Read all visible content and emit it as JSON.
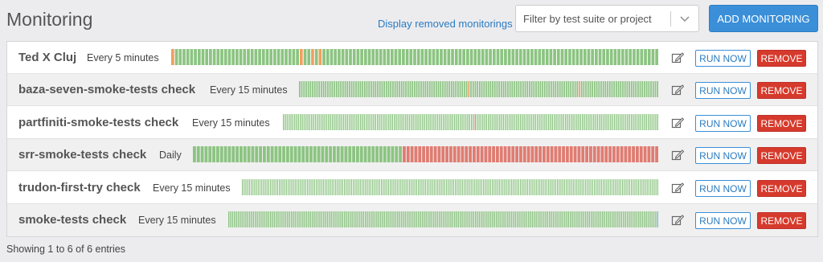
{
  "header": {
    "title": "Monitoring",
    "removed_link": "Display removed monitorings",
    "filter_placeholder": "Filter by test suite or project",
    "filter_icon": "chevron-down-icon",
    "add_label": "ADD MONITORING"
  },
  "colors": {
    "ok": "#8cc482",
    "warn": "#f0a060",
    "fail": "#e07c72",
    "running": "#7fb3e8",
    "primary": "#3a8fd8",
    "danger": "#d63a2c"
  },
  "actions": {
    "edit_icon": "edit-icon",
    "run_label": "RUN NOW",
    "remove_label": "REMOVE"
  },
  "monitorings": [
    {
      "name": "Ted X Cluj",
      "frequency": "Every 5 minutes",
      "history": "WOOOOOOOOOOOOOOOOOOOOOOOOOOOOOOOOOWOOWOWOOOOOOOOOOOOOOOOOOOOOOOOOOOOOOOOOOOOOOOOOOOOOOOOOOOOOOOOOOOOOOOOOOOOOOOOOOOOOOOOOOOOOOOOO"
    },
    {
      "name": "baza-seven-smoke-tests check",
      "frequency": "Every 15 minutes",
      "history": "OOOOOOOOOOOOOOOOOOOOOOOOOOOOOOOOOOOOOOOOOOOOOOOOOOOOOOOOOOOOOOOOOOOOOOOOOOOOOOWOOOOOOOOOOOOOOOOOOOOOOOOOOOOOOOOOOOOOOOOOOOOOOOOOOWOOOOOOOOOOOOOOOOOOOOOOOOOOOOOOOOOOOO"
    },
    {
      "name": "partfiniti-smoke-tests check",
      "frequency": "Every 15 minutes",
      "history": "OOOOOOOOOOOOOOOOOOOOOOOOOOOOOOOOOOOOOOOOOOOOOOOOOOOOOOOOOOOOOOOOOOOOOOOOOOOOOOOOOOOOOOOOOOOOOOOOOOOOOOFOOOOOOOOOOOOOOOOOOOOOOOOOOOOOOOOOOOOOOOOOOOOOOOOOOOOOOOOOOOOOOOOOOOOOOOOOOOOOOOOOOOOOOOOOOOOOOOOO"
    },
    {
      "name": "srr-smoke-tests check",
      "frequency": "Daily",
      "history": "OOOOOOOOOOOOOOOOOOOOOOOOOOOOOOOOOOOOOOOOOOOOOOOOOOOOOOFFFFFFFFFFFFFFFFFFFFFFFFFFFFFFFFFFFFFFFFFFFFFFFFFFFFFFFFFFFFFFFFFF"
    },
    {
      "name": "trudon-first-try check",
      "frequency": "Every 15 minutes",
      "history": "OOOOOOOOOOOOOOOOOOOOOOOOOOOOOOOOOOOOOOOOOOOOOOOOOOOOOOOOOOOOOOOOOOOOOOOOOOOOOOOOOOOOOOOOOOOOOOOOOOOOOOOOOOOOOOOOOOOOOOOOOOOOOOOOOOOOOOOOOOOOOOOOOOOOOOOOOOOOOOOOOOOOOOOOOOOOOOOOOOOOOOOOOOOOOOOOOOOOOOOOOOOOOOOOOOOOOOOOOOOOOOOOOOOOOOOOOOOOO"
    },
    {
      "name": "smoke-tests check",
      "frequency": "Every 15 minutes",
      "history": "OOOOOOOOOOOOOOOOOOOOOOOOOOOOOOOOOOOOOOOOOOOOOOOOOOOOOOOOOOOOOOOOOOOOOOOOOOOOOOOOOOOOOOOOOOOOOOOOOOOOOOOOOOOOOOOOOOOOOOOOOOOOOOOOOOOOOOOOOOOOOOOOOOOOOOOOOOOOOOOOOOOOOOOOOOOOOOOOOOOOOOOOOOOOOOOOOOOOOOOOOOOOOOOOOOOOOOOOOOOOOOOOOOR"
    }
  ],
  "footer": {
    "entries": "Showing 1 to 6 of 6 entries"
  }
}
